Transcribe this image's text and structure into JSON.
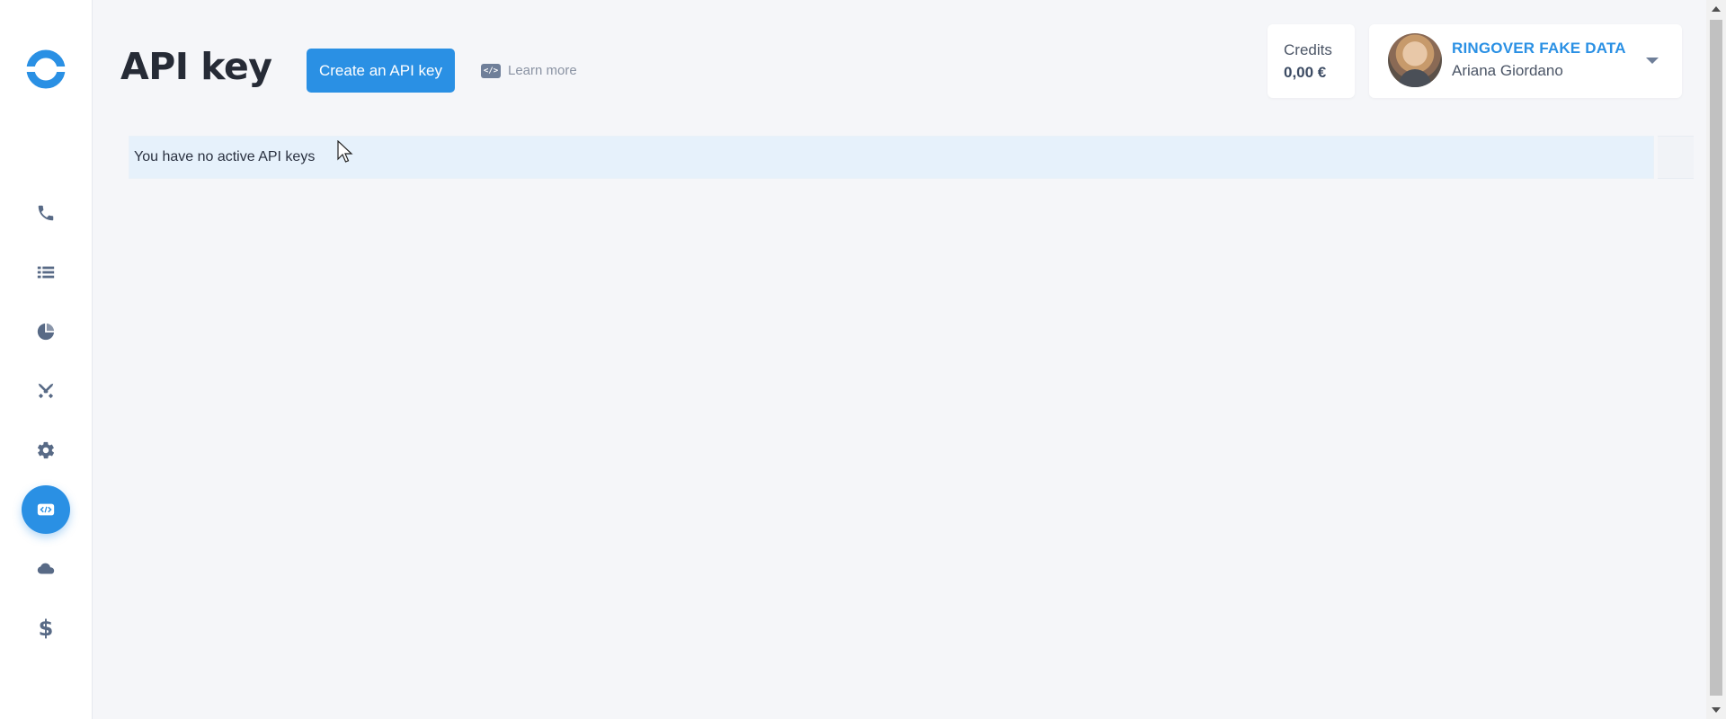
{
  "header": {
    "title": "API key",
    "create_button_label": "Create an API key",
    "learn_more_label": "Learn more",
    "learn_more_icon": "code-icon"
  },
  "credits": {
    "label": "Credits",
    "value": "0,00 €"
  },
  "user": {
    "company": "RINGOVER FAKE DATA",
    "name": "Ariana Giordano"
  },
  "main": {
    "empty_message": "You have no active API keys"
  },
  "sidebar": {
    "items": [
      {
        "name": "phone",
        "icon": "phone-icon"
      },
      {
        "name": "list",
        "icon": "list-icon"
      },
      {
        "name": "statistics",
        "icon": "pie-chart-icon"
      },
      {
        "name": "tools",
        "icon": "tools-icon"
      },
      {
        "name": "settings",
        "icon": "gear-icon"
      },
      {
        "name": "api",
        "icon": "code-icon",
        "active": true
      },
      {
        "name": "cloud",
        "icon": "cloud-icon"
      },
      {
        "name": "billing",
        "icon": "dollar-icon",
        "glyph": "$"
      }
    ]
  },
  "colors": {
    "accent": "#2a90e4",
    "notice_bg": "#e6f1fb",
    "background": "#f5f6f9"
  }
}
